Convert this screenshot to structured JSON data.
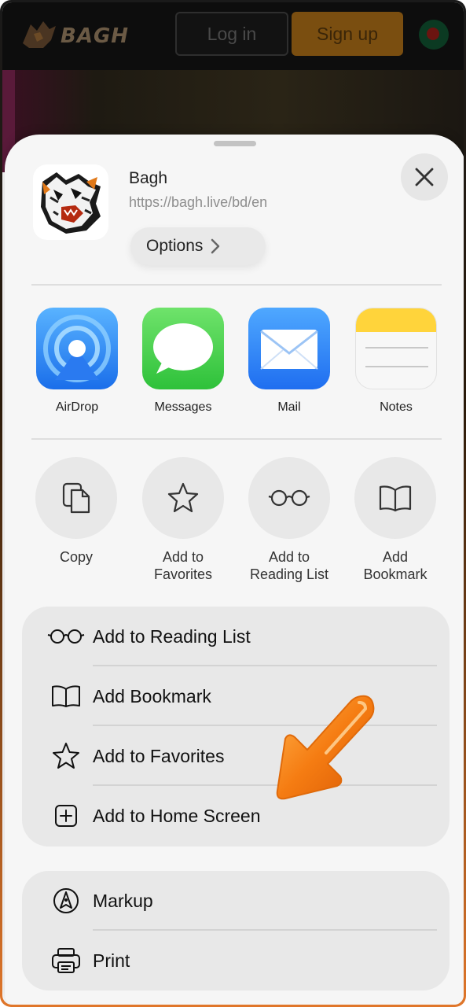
{
  "site": {
    "logo_text": "BAGH",
    "login_label": "Log in",
    "signup_label": "Sign up"
  },
  "sheet": {
    "title": "Bagh",
    "url": "https://bagh.live/bd/en",
    "options_label": "Options"
  },
  "apps": [
    {
      "label": "AirDrop",
      "icon": "airdrop-icon"
    },
    {
      "label": "Messages",
      "icon": "messages-icon"
    },
    {
      "label": "Mail",
      "icon": "mail-icon"
    },
    {
      "label": "Notes",
      "icon": "notes-icon"
    }
  ],
  "actions": [
    {
      "label": "Copy",
      "icon": "copy-icon"
    },
    {
      "label": "Add to Favorites",
      "icon": "star-icon"
    },
    {
      "label": "Add to Reading List",
      "icon": "glasses-icon"
    },
    {
      "label": "Add Bookmark",
      "icon": "book-icon"
    }
  ],
  "menu_group_1": [
    {
      "label": "Add to Reading List",
      "icon": "glasses-icon"
    },
    {
      "label": "Add Bookmark",
      "icon": "book-icon"
    },
    {
      "label": "Add to Favorites",
      "icon": "star-icon"
    },
    {
      "label": "Add to Home Screen",
      "icon": "plus-square-icon"
    }
  ],
  "menu_group_2": [
    {
      "label": "Markup",
      "icon": "markup-icon"
    },
    {
      "label": "Print",
      "icon": "printer-icon"
    }
  ],
  "colors": {
    "accent_orange": "#f07a1a",
    "airdrop_blue": "#1a6eea",
    "messages_green": "#2ec13a",
    "notes_yellow": "#ffd43b"
  }
}
